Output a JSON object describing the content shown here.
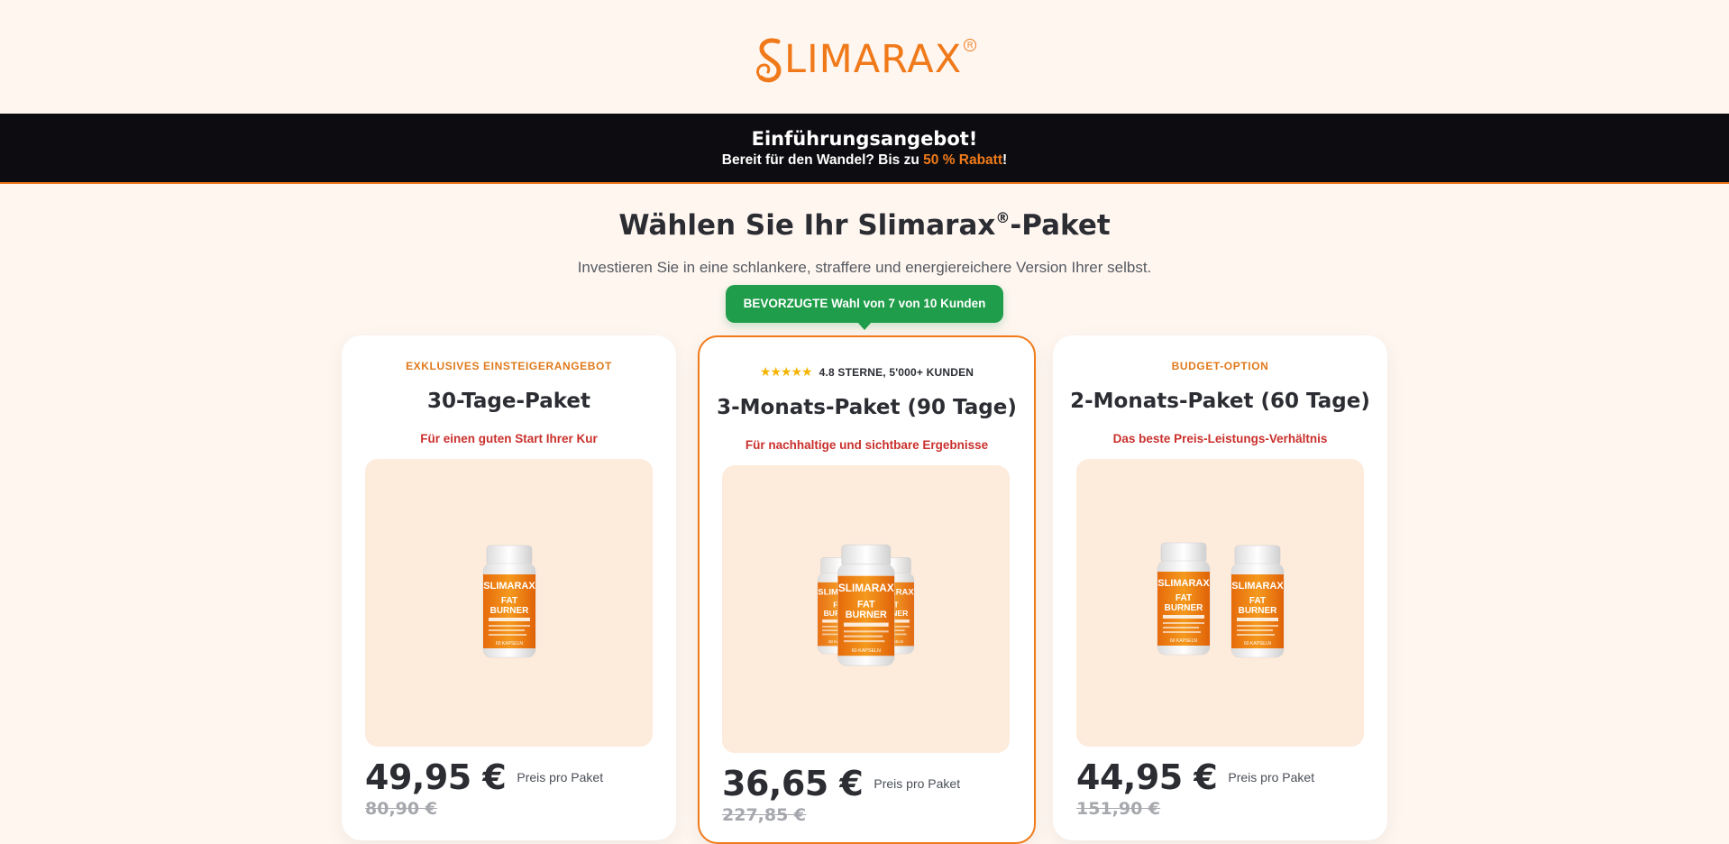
{
  "brand": {
    "name": "LIMARAX",
    "initial": "S",
    "reg": "R"
  },
  "banner": {
    "title": "Einführungsangebot!",
    "sub_prefix": "Bereit für den Wandel? Bis zu ",
    "sub_accent": "50 % Rabatt",
    "sub_suffix": "!"
  },
  "heading": {
    "main": "Wählen Sie Ihr Slimarax",
    "reg": "®",
    "suffix": "-Paket"
  },
  "subheading": "Investieren Sie in eine schlankere, straffere und energiereichere Version Ihrer selbst.",
  "badge": "BEVORZUGTE Wahl von 7 von 10 Kunden",
  "bottle": {
    "brand": "LIMARAX",
    "initial": "S",
    "line1": "FAT BURNER",
    "caps": "60 KAPSELN"
  },
  "cards": [
    {
      "tag": "EXKLUSIVES EINSTEIGERANGEBOT",
      "title": "30-Tage-Paket",
      "subtitle": "Für einen guten Start Ihrer Kur",
      "price": "49,95 €",
      "price_note": "Preis pro Paket",
      "old_price": "80,90 €",
      "bottles": 1
    },
    {
      "stars": "★★★★★",
      "rating": "4.8 STERNE, 5'000+ KUNDEN",
      "title": "3-Monats-Paket (90 Tage)",
      "subtitle": "Für nachhaltige und sichtbare Ergebnisse",
      "price": "36,65 €",
      "price_note": "Preis pro Paket",
      "old_price": "227,85 €",
      "bottles": 3
    },
    {
      "tag": "BUDGET-OPTION",
      "title": "2-Monats-Paket (60 Tage)",
      "subtitle": "Das beste Preis-Leistungs-Verhältnis",
      "price": "44,95 €",
      "price_note": "Preis pro Paket",
      "old_price": "151,90 €",
      "bottles": 2
    }
  ],
  "colors": {
    "accent": "#f07a1a",
    "green": "#1f9d4a",
    "banner": "#0d0d11",
    "bg": "#fff6f0",
    "red_sub": "#c9302c"
  }
}
